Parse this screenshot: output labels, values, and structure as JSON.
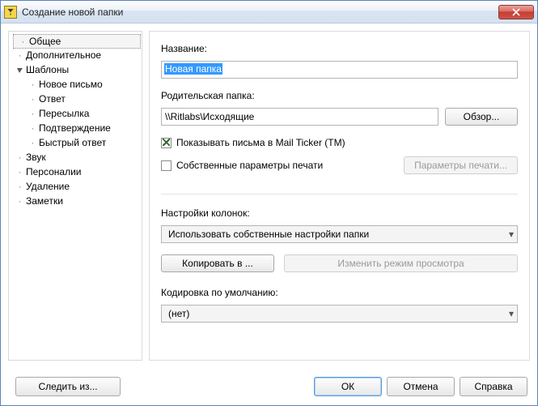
{
  "window": {
    "title": "Создание новой папки"
  },
  "tree": {
    "items": [
      {
        "label": "Общее",
        "level": 0,
        "selected": true,
        "toggle": "leaf"
      },
      {
        "label": "Дополнительное",
        "level": 0,
        "toggle": "leaf"
      },
      {
        "label": "Шаблоны",
        "level": 0,
        "toggle": "open"
      },
      {
        "label": "Новое письмо",
        "level": 1,
        "toggle": "leaf"
      },
      {
        "label": "Ответ",
        "level": 1,
        "toggle": "leaf"
      },
      {
        "label": "Пересылка",
        "level": 1,
        "toggle": "leaf"
      },
      {
        "label": "Подтверждение",
        "level": 1,
        "toggle": "leaf"
      },
      {
        "label": "Быстрый ответ",
        "level": 1,
        "toggle": "leaf"
      },
      {
        "label": "Звук",
        "level": 0,
        "toggle": "leaf"
      },
      {
        "label": "Персоналии",
        "level": 0,
        "toggle": "leaf"
      },
      {
        "label": "Удаление",
        "level": 0,
        "toggle": "leaf"
      },
      {
        "label": "Заметки",
        "level": 0,
        "toggle": "leaf"
      }
    ]
  },
  "main": {
    "name_label": "Название:",
    "name_value": "Новая папка",
    "parent_label": "Родительская папка:",
    "parent_value": "\\\\Ritlabs\\Исходящие",
    "browse_btn": "Обзор...",
    "mailticker_checked": true,
    "mailticker_label": "Показывать письма в Mail Ticker (TM)",
    "ownprint_checked": false,
    "ownprint_label": "Собственные параметры печати",
    "print_params_btn": "Параметры печати...",
    "columns_label": "Настройки колонок:",
    "columns_value": "Использовать собственные настройки папки",
    "copy_to_btn": "Копировать в ...",
    "change_view_btn": "Изменить режим просмотра",
    "encoding_label": "Кодировка по умолчанию:",
    "encoding_value": "(нет)"
  },
  "footer": {
    "watch_btn": "Следить из...",
    "ok": "ОК",
    "cancel": "Отмена",
    "help": "Справка"
  }
}
